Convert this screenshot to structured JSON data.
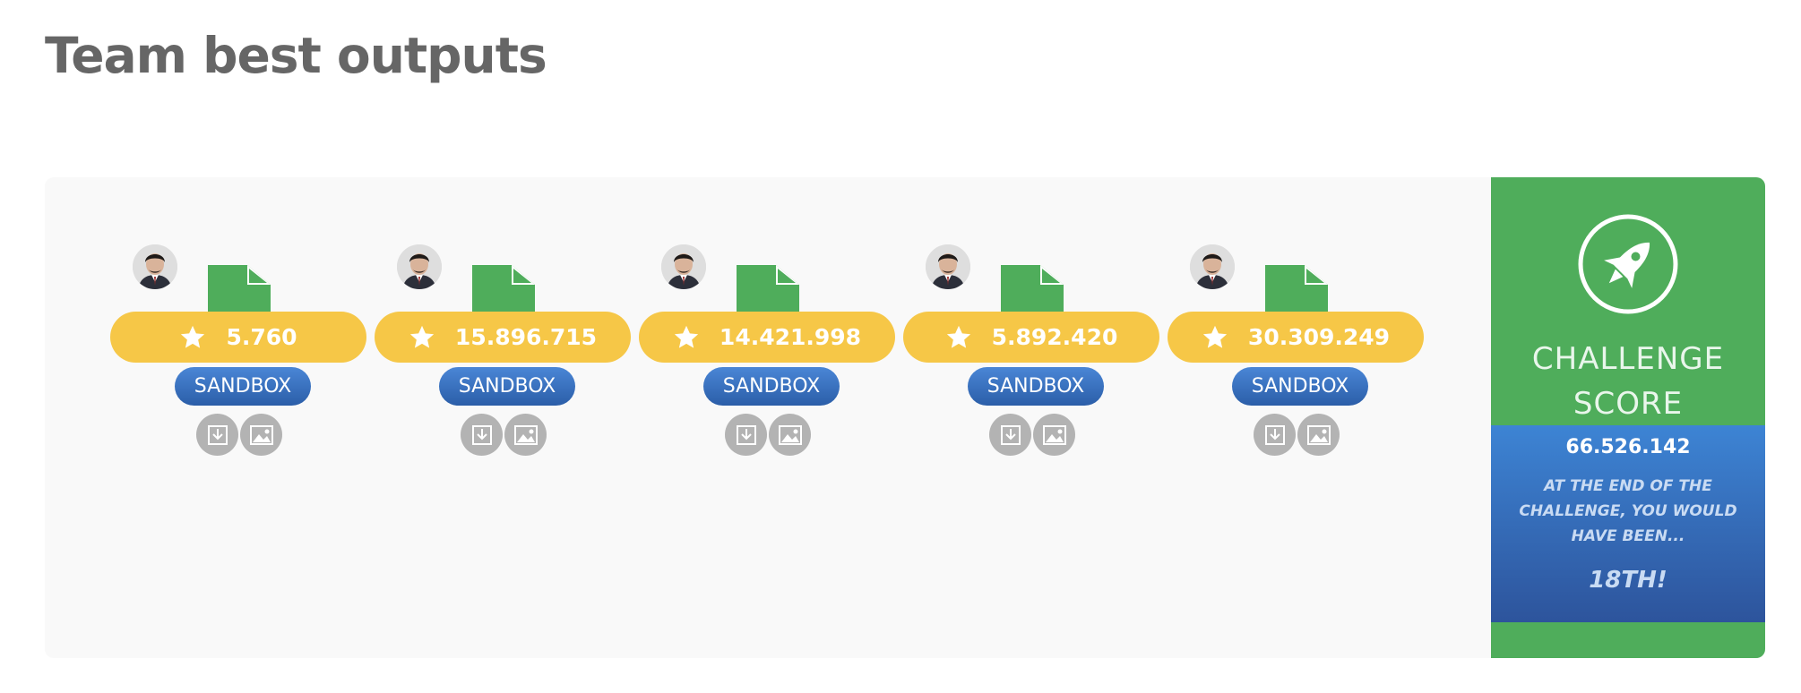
{
  "page": {
    "title": "Team best outputs"
  },
  "colors": {
    "score_pill": "#f6c747",
    "sandbox": "#2e62ad",
    "file": "#4fad5b",
    "score_card": "#4fad5b",
    "score_blue": "#3b74c4",
    "action_icon_bg": "#b3b3b3"
  },
  "icons": {
    "star": "star-icon",
    "file": "file-icon",
    "download": "download-icon",
    "image": "image-icon",
    "rocket": "rocket-icon",
    "avatar": "avatar"
  },
  "outputs": [
    {
      "score": "5.760",
      "label": "SANDBOX"
    },
    {
      "score": "15.896.715",
      "label": "SANDBOX"
    },
    {
      "score": "14.421.998",
      "label": "SANDBOX"
    },
    {
      "score": "5.892.420",
      "label": "SANDBOX"
    },
    {
      "score": "30.309.249",
      "label": "SANDBOX"
    }
  ],
  "challenge": {
    "title_line1": "CHALLENGE",
    "title_line2": "SCORE",
    "score": "66.526.142",
    "description": "AT THE END OF THE CHALLENGE, YOU WOULD HAVE BEEN...",
    "rank": "18TH!"
  }
}
